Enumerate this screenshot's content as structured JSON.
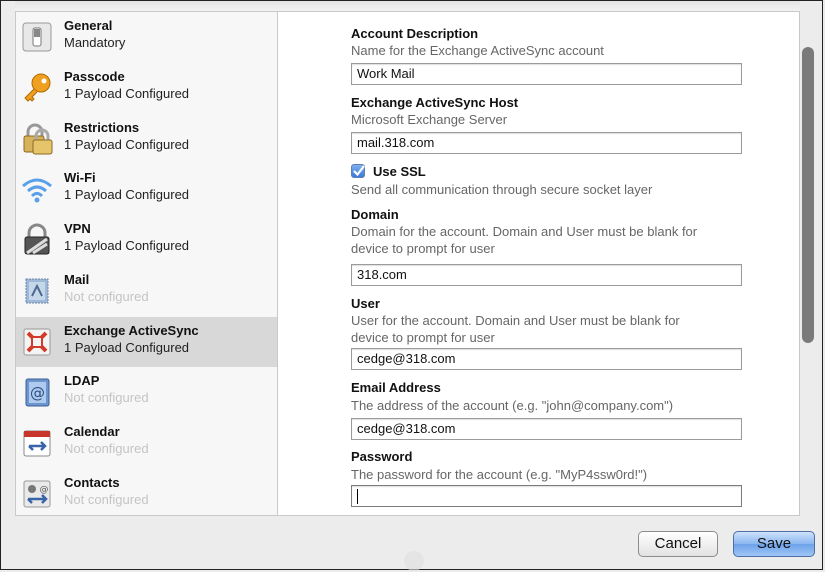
{
  "sidebar": {
    "items": [
      {
        "name": "General",
        "status": "Mandatory",
        "configured": true,
        "icon": "switch-icon"
      },
      {
        "name": "Passcode",
        "status": "1 Payload Configured",
        "configured": true,
        "icon": "key-icon"
      },
      {
        "name": "Restrictions",
        "status": "1 Payload Configured",
        "configured": true,
        "icon": "padlock-icon"
      },
      {
        "name": "Wi-Fi",
        "status": "1 Payload Configured",
        "configured": true,
        "icon": "wifi-icon"
      },
      {
        "name": "VPN",
        "status": "1 Payload Configured",
        "configured": true,
        "icon": "vpn-lock-icon"
      },
      {
        "name": "Mail",
        "status": "Not configured",
        "configured": false,
        "icon": "mail-stamp-icon"
      },
      {
        "name": "Exchange ActiveSync",
        "status": "1 Payload Configured",
        "configured": true,
        "selected": true,
        "icon": "exchange-icon"
      },
      {
        "name": "LDAP",
        "status": "Not configured",
        "configured": false,
        "icon": "at-book-icon"
      },
      {
        "name": "Calendar",
        "status": "Not configured",
        "configured": false,
        "icon": "calendar-icon"
      },
      {
        "name": "Contacts",
        "status": "Not configured",
        "configured": false,
        "icon": "contacts-icon"
      }
    ]
  },
  "form": {
    "account_description": {
      "title": "Account Description",
      "desc": "Name for the Exchange ActiveSync account",
      "value": "Work Mail"
    },
    "host": {
      "title": "Exchange ActiveSync Host",
      "desc": "Microsoft Exchange Server",
      "value": "mail.318.com"
    },
    "ssl": {
      "label": "Use SSL",
      "desc": "Send all communication through secure socket layer",
      "checked": true
    },
    "domain": {
      "title": "Domain",
      "desc": "Domain for the account. Domain and User must be blank for device to prompt for user",
      "value": "318.com"
    },
    "user": {
      "title": "User",
      "desc": "User for the account. Domain and User must be blank for device to prompt for user",
      "value": "cedge@318.com"
    },
    "email": {
      "title": "Email Address",
      "desc": "The address of the account (e.g. \"john@company.com\")",
      "value": "cedge@318.com"
    },
    "password": {
      "title": "Password",
      "desc": "The password for the account (e.g. \"MyP4ssw0rd!\")",
      "value": ""
    }
  },
  "buttons": {
    "cancel": "Cancel",
    "save": "Save"
  },
  "colors": {
    "selected_row": "#d8d8d8",
    "save_button": "#8ab6f0",
    "muted_text": "#c4c4c4"
  }
}
